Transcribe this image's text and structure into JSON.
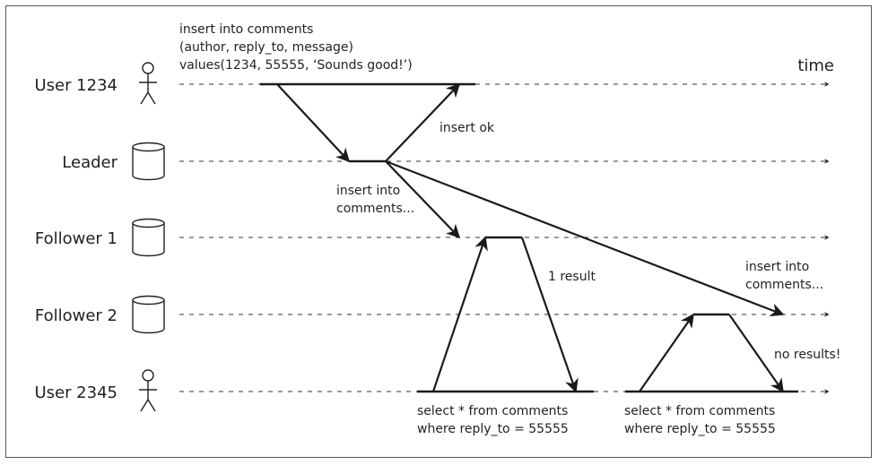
{
  "diagram": {
    "time_label": "time",
    "actors": [
      {
        "id": "user1234",
        "label": "User 1234",
        "icon": "person-icon"
      },
      {
        "id": "leader",
        "label": "Leader",
        "icon": "database-icon"
      },
      {
        "id": "follower1",
        "label": "Follower 1",
        "icon": "database-icon"
      },
      {
        "id": "follower2",
        "label": "Follower 2",
        "icon": "database-icon"
      },
      {
        "id": "user2345",
        "label": "User 2345",
        "icon": "person-icon"
      }
    ],
    "notes": {
      "insert_query": [
        "insert into comments",
        "(author, reply_to, message)",
        "values(1234, 55555, ‘Sounds good!’)"
      ],
      "insert_ok": "insert ok",
      "replicate_f1": [
        "insert into",
        "comments..."
      ],
      "replicate_f2": [
        "insert into",
        "comments..."
      ],
      "one_result": "1 result",
      "no_results": "no results!",
      "select_1": [
        "select * from comments",
        "where reply_to = 55555"
      ],
      "select_2": [
        "select * from comments",
        "where reply_to = 55555"
      ]
    },
    "messages": [
      {
        "from": "user1234",
        "to": "leader",
        "meaning": "insert request"
      },
      {
        "from": "leader",
        "to": "user1234",
        "meaning": "insert ok"
      },
      {
        "from": "leader",
        "to": "follower1",
        "meaning": "replication (fast)"
      },
      {
        "from": "leader",
        "to": "follower2",
        "meaning": "replication (delayed)"
      },
      {
        "from": "user2345",
        "to": "follower1",
        "meaning": "read query"
      },
      {
        "from": "follower1",
        "to": "user2345",
        "meaning": "1 result"
      },
      {
        "from": "user2345",
        "to": "follower2",
        "meaning": "read query"
      },
      {
        "from": "follower2",
        "to": "user2345",
        "meaning": "no results"
      }
    ]
  }
}
